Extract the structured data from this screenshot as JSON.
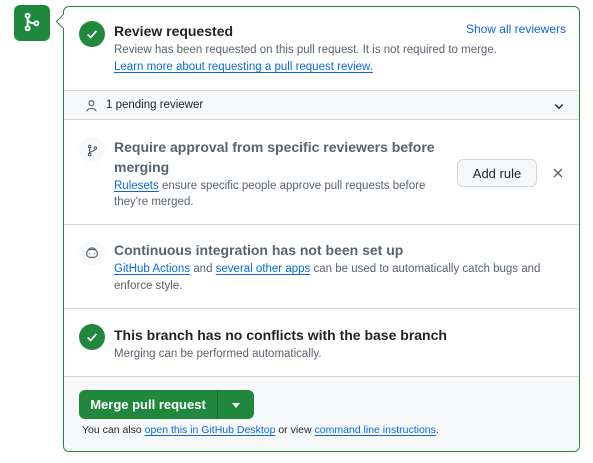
{
  "colors": {
    "accent": "#1f883d",
    "link": "#0969da",
    "muted": "#59636e",
    "border": "#d0d7de"
  },
  "icons": {
    "badge": "git-merge-icon",
    "review": "check-circle-icon",
    "pending": "person-icon",
    "expand": "chevron-down-icon",
    "rules": "git-branch-icon",
    "dismiss": "close-icon",
    "ci": "robot-icon",
    "conflicts": "check-circle-icon",
    "merge_dropdown": "triangle-down-icon"
  },
  "review": {
    "title": "Review requested",
    "show_all": "Show all reviewers",
    "description": "Review has been requested on this pull request. It is not required to merge.",
    "learn_more": "Learn more about requesting a pull request review."
  },
  "pending": {
    "label": "1 pending reviewer"
  },
  "rules": {
    "title_line1": "Require approval from specific reviewers before",
    "title_line2": "merging",
    "link": "Rulesets",
    "text_line1": " ensure specific people approve pull requests before",
    "text_line2": "they're merged.",
    "add_rule": "Add rule",
    "dismiss": "×"
  },
  "ci": {
    "title": "Continuous integration has not been set up",
    "link1": "GitHub Actions",
    "and": " and ",
    "link2": "several other apps",
    "text_line1": " can be used to automatically catch bugs and",
    "text_line2": "enforce style."
  },
  "conflicts": {
    "title": "This branch has no conflicts with the base branch",
    "description": "Merging can be performed automatically."
  },
  "merge": {
    "button": "Merge pull request",
    "also": "You can also ",
    "desktop_link": "open this in GitHub Desktop",
    "or_view": " or view ",
    "cli_link": "command line instructions",
    "period": "."
  }
}
